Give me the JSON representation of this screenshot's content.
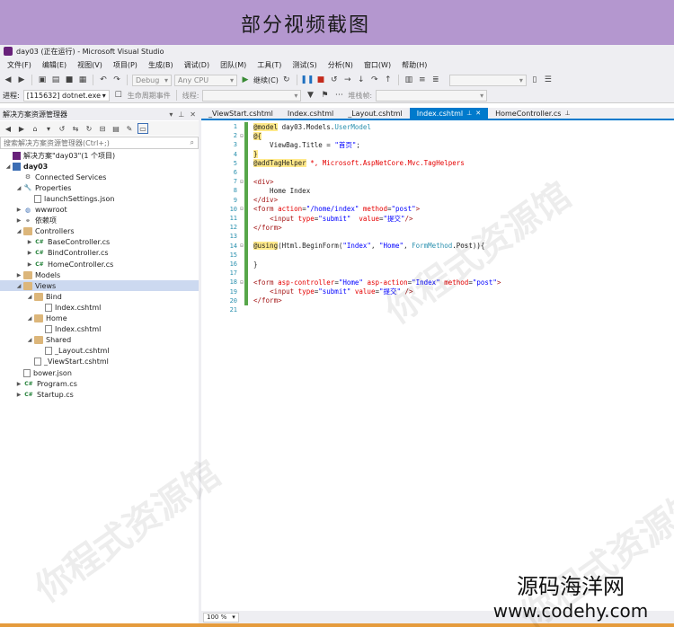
{
  "banner": {
    "title": "部分视频截图"
  },
  "window": {
    "title": "day03 (正在运行) - Microsoft Visual Studio"
  },
  "menu": [
    "文件(F)",
    "编辑(E)",
    "视图(V)",
    "项目(P)",
    "生成(B)",
    "调试(D)",
    "团队(M)",
    "工具(T)",
    "测试(S)",
    "分析(N)",
    "窗口(W)",
    "帮助(H)"
  ],
  "toolbar": {
    "config": "Debug",
    "platform": "Any CPU",
    "continue_label": "继续(C)"
  },
  "toolbar2": {
    "process_label": "进程:",
    "process_value": "[115632] dotnet.exe",
    "lifecycle_label": "生命周期事件",
    "thread_label": "线程:",
    "stackframe_label": "堆栈帧:"
  },
  "solution_explorer": {
    "title": "解决方案资源管理器",
    "search_placeholder": "搜索解决方案资源管理器(Ctrl+;)",
    "items": [
      {
        "label": "解决方案\"day03\"(1 个项目)",
        "indent": 0,
        "icon": "solution-icon",
        "arrow": ""
      },
      {
        "label": "day03",
        "indent": 0,
        "icon": "project-icon",
        "arrow": "▲",
        "bold": true
      },
      {
        "label": "Connected Services",
        "indent": 1,
        "icon": "connected-services-icon",
        "arrow": ""
      },
      {
        "label": "Properties",
        "indent": 1,
        "icon": "wrench-icon",
        "arrow": "▲"
      },
      {
        "label": "launchSettings.json",
        "indent": 2,
        "icon": "file-icon",
        "arrow": ""
      },
      {
        "label": "wwwroot",
        "indent": 1,
        "icon": "globe-icon",
        "arrow": "▶"
      },
      {
        "label": "依赖项",
        "indent": 1,
        "icon": "dependencies-icon",
        "arrow": "▶"
      },
      {
        "label": "Controllers",
        "indent": 1,
        "icon": "folder-icon",
        "arrow": "▲"
      },
      {
        "label": "BaseController.cs",
        "indent": 2,
        "icon": "cs-file-icon",
        "arrow": "▶"
      },
      {
        "label": "BindController.cs",
        "indent": 2,
        "icon": "cs-file-icon",
        "arrow": "▶"
      },
      {
        "label": "HomeController.cs",
        "indent": 2,
        "icon": "cs-file-icon",
        "arrow": "▶"
      },
      {
        "label": "Models",
        "indent": 1,
        "icon": "folder-icon",
        "arrow": "▶"
      },
      {
        "label": "Views",
        "indent": 1,
        "icon": "folder-icon",
        "arrow": "▲",
        "selected": true
      },
      {
        "label": "Bind",
        "indent": 2,
        "icon": "folder-icon",
        "arrow": "▲"
      },
      {
        "label": "Index.cshtml",
        "indent": 3,
        "icon": "file-icon",
        "arrow": ""
      },
      {
        "label": "Home",
        "indent": 2,
        "icon": "folder-icon",
        "arrow": "▲"
      },
      {
        "label": "Index.cshtml",
        "indent": 3,
        "icon": "file-icon",
        "arrow": ""
      },
      {
        "label": "Shared",
        "indent": 2,
        "icon": "folder-icon",
        "arrow": "▲"
      },
      {
        "label": "_Layout.cshtml",
        "indent": 3,
        "icon": "file-icon",
        "arrow": ""
      },
      {
        "label": "_ViewStart.cshtml",
        "indent": 2,
        "icon": "file-icon",
        "arrow": ""
      },
      {
        "label": "bower.json",
        "indent": 1,
        "icon": "file-icon",
        "arrow": ""
      },
      {
        "label": "Program.cs",
        "indent": 1,
        "icon": "cs-file-icon",
        "arrow": "▶"
      },
      {
        "label": "Startup.cs",
        "indent": 1,
        "icon": "cs-file-icon",
        "arrow": "▶"
      }
    ]
  },
  "tabs": [
    {
      "label": "_ViewStart.cshtml",
      "active": false
    },
    {
      "label": "Index.cshtml",
      "active": false
    },
    {
      "label": "_Layout.cshtml",
      "active": false
    },
    {
      "label": "Index.cshtml",
      "active": true
    },
    {
      "label": "HomeController.cs",
      "active": false
    }
  ],
  "editor": {
    "lines": [
      {
        "n": "1",
        "fold": "",
        "parts": [
          [
            "dir",
            "@model"
          ],
          [
            "plain",
            " day03.Models."
          ],
          [
            "type",
            "UserModel"
          ]
        ]
      },
      {
        "n": "2",
        "fold": "⊟",
        "parts": [
          [
            "dir",
            "@{"
          ]
        ]
      },
      {
        "n": "3",
        "fold": "",
        "parts": [
          [
            "plain",
            "    ViewBag.Title = "
          ],
          [
            "str",
            "\"首页\""
          ],
          [
            "plain",
            ";"
          ]
        ]
      },
      {
        "n": "4",
        "fold": "",
        "parts": [
          [
            "dir",
            "}"
          ]
        ]
      },
      {
        "n": "5",
        "fold": "",
        "parts": [
          [
            "dir",
            "@addTagHelper"
          ],
          [
            "plain",
            " "
          ],
          [
            "attr",
            "*, Microsoft.AspNetCore.Mvc.TagHelpers"
          ]
        ]
      },
      {
        "n": "6",
        "fold": "",
        "parts": []
      },
      {
        "n": "7",
        "fold": "⊟",
        "parts": [
          [
            "tag",
            "<div>"
          ]
        ]
      },
      {
        "n": "8",
        "fold": "",
        "parts": [
          [
            "plain",
            "    Home Index"
          ]
        ]
      },
      {
        "n": "9",
        "fold": "",
        "parts": [
          [
            "tag",
            "</div>"
          ]
        ]
      },
      {
        "n": "10",
        "fold": "⊟",
        "parts": [
          [
            "tag",
            "<form "
          ],
          [
            "attr",
            "action"
          ],
          [
            "plain",
            "="
          ],
          [
            "str",
            "\"/home/index\""
          ],
          [
            "plain",
            " "
          ],
          [
            "attr",
            "method"
          ],
          [
            "plain",
            "="
          ],
          [
            "str",
            "\"post\""
          ],
          [
            "tag",
            ">"
          ]
        ]
      },
      {
        "n": "11",
        "fold": "",
        "parts": [
          [
            "plain",
            "    "
          ],
          [
            "tag",
            "<input "
          ],
          [
            "attr",
            "type"
          ],
          [
            "plain",
            "="
          ],
          [
            "str",
            "\"submit\""
          ],
          [
            "plain",
            "  "
          ],
          [
            "attr",
            "value"
          ],
          [
            "plain",
            "="
          ],
          [
            "str",
            "\"提交\""
          ],
          [
            "tag",
            "/>"
          ]
        ]
      },
      {
        "n": "12",
        "fold": "",
        "parts": [
          [
            "tag",
            "</form>"
          ]
        ]
      },
      {
        "n": "13",
        "fold": "",
        "parts": []
      },
      {
        "n": "14",
        "fold": "⊟",
        "parts": [
          [
            "dir",
            "@using"
          ],
          [
            "plain",
            "(Html.BeginForm("
          ],
          [
            "str",
            "\"Index\""
          ],
          [
            "plain",
            ", "
          ],
          [
            "str",
            "\"Home\""
          ],
          [
            "plain",
            ", "
          ],
          [
            "type",
            "FormMethod"
          ],
          [
            "plain",
            ".Post)){"
          ]
        ]
      },
      {
        "n": "15",
        "fold": "",
        "parts": []
      },
      {
        "n": "16",
        "fold": "",
        "parts": [
          [
            "plain",
            "}"
          ]
        ]
      },
      {
        "n": "17",
        "fold": "",
        "parts": []
      },
      {
        "n": "18",
        "fold": "⊟",
        "parts": [
          [
            "tag",
            "<form "
          ],
          [
            "attr",
            "asp-controller"
          ],
          [
            "plain",
            "="
          ],
          [
            "str",
            "\"Home\""
          ],
          [
            "plain",
            " "
          ],
          [
            "attr",
            "asp-action"
          ],
          [
            "plain",
            "="
          ],
          [
            "str",
            "\"Index\""
          ],
          [
            "plain",
            " "
          ],
          [
            "attr",
            "method"
          ],
          [
            "plain",
            "="
          ],
          [
            "str",
            "\"post\""
          ],
          [
            "tag",
            ">"
          ]
        ]
      },
      {
        "n": "19",
        "fold": "",
        "parts": [
          [
            "plain",
            "    "
          ],
          [
            "tag",
            "<input "
          ],
          [
            "attr",
            "type"
          ],
          [
            "plain",
            "="
          ],
          [
            "str",
            "\"submit\""
          ],
          [
            "plain",
            " "
          ],
          [
            "attr",
            "value"
          ],
          [
            "plain",
            "="
          ],
          [
            "str",
            "\"提交\""
          ],
          [
            "plain",
            " "
          ],
          [
            "tag",
            "/>"
          ]
        ]
      },
      {
        "n": "20",
        "fold": "",
        "parts": [
          [
            "tag",
            "</form>"
          ]
        ]
      },
      {
        "n": "21",
        "fold": "",
        "parts": []
      }
    ]
  },
  "status": {
    "zoom": "100 %"
  },
  "watermark": "你程式资源馆",
  "brand": {
    "name": "源码海洋网",
    "url": "www.codehy.com"
  }
}
